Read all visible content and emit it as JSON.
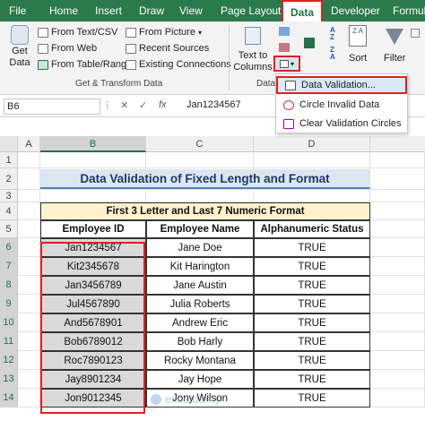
{
  "tabs": [
    "File",
    "Home",
    "Insert",
    "Draw",
    "View",
    "Page Layout",
    "Data",
    "Developer",
    "Formul"
  ],
  "active_tab": "Data",
  "ribbon": {
    "get_data": [
      "Get",
      "Data"
    ],
    "get_items": [
      "From Text/CSV",
      "From Web",
      "From Table/Range"
    ],
    "get_items2": [
      "From Picture",
      "Recent Sources",
      "Existing Connections"
    ],
    "group_label": "Get & Transform Data",
    "text_to_columns": [
      "Text to",
      "Columns"
    ],
    "data_group_label": "Data",
    "sort_label": "Sort",
    "filter_label": "Filter"
  },
  "menu": {
    "items": [
      "Data Validation...",
      "Circle Invalid Data",
      "Clear Validation Circles"
    ]
  },
  "formula_bar": {
    "name_box": "B6",
    "fx": "fx",
    "value": "Jan1234567"
  },
  "columns": [
    "A",
    "B",
    "C",
    "D"
  ],
  "rows": [
    "1",
    "2",
    "3",
    "4",
    "5",
    "6",
    "7",
    "8",
    "9",
    "10",
    "11",
    "12",
    "13",
    "14"
  ],
  "sheet": {
    "title": "Data Validation of Fixed Length and Format",
    "subtitle": "First 3 Letter and Last 7 Numeric Format",
    "headers": [
      "Employee ID",
      "Employee Name",
      "Alphanumeric Status"
    ],
    "rows": [
      [
        "Jan1234567",
        "Jane Doe",
        "TRUE"
      ],
      [
        "Kit2345678",
        "Kit Harington",
        "TRUE"
      ],
      [
        "Jan3456789",
        "Jane Austin",
        "TRUE"
      ],
      [
        "Jul4567890",
        "Julia Roberts",
        "TRUE"
      ],
      [
        "And5678901",
        "Andrew Eric",
        "TRUE"
      ],
      [
        "Bob6789012",
        "Bob Harly",
        "TRUE"
      ],
      [
        "Roc7890123",
        "Rocky Montana",
        "TRUE"
      ],
      [
        "Jay8901234",
        "Jay Hope",
        "TRUE"
      ],
      [
        "Jon9012345",
        "Jony Wilson",
        "TRUE"
      ]
    ]
  },
  "watermark": "exceldemy",
  "colors": {
    "excel_green": "#217346",
    "highlight_red": "#e02020",
    "title_fill": "#dce6f1",
    "subtitle_fill": "#fff2cc",
    "selected_fill": "#d9d9d9"
  }
}
